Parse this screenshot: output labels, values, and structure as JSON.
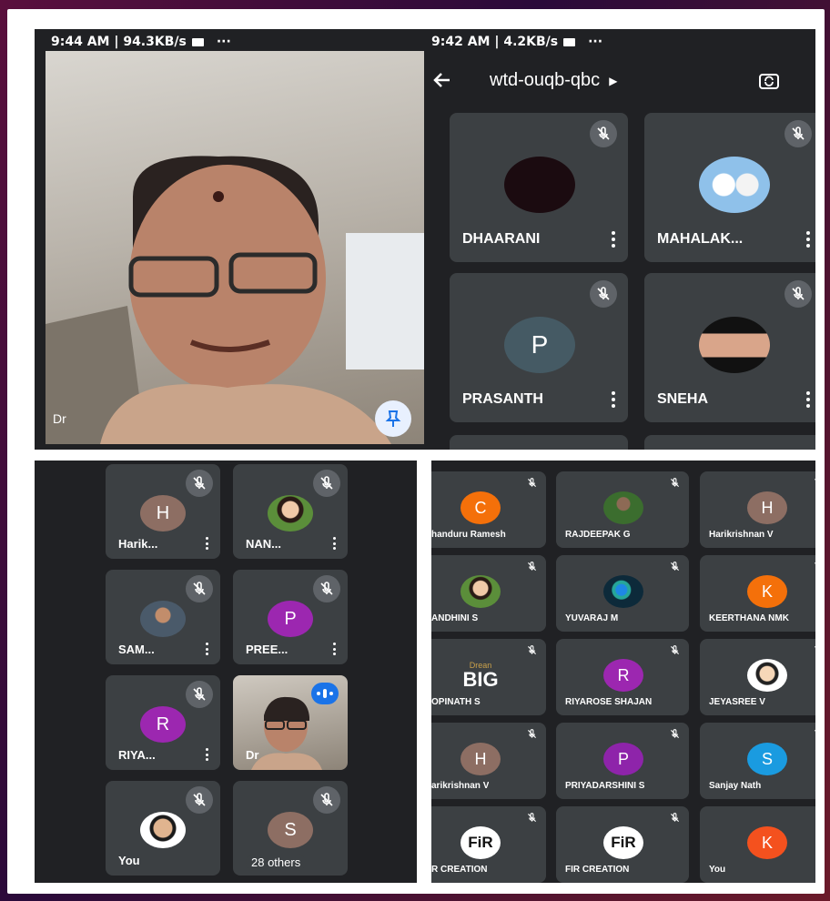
{
  "panel_a": {
    "status_left": "9:44 AM | 94.3KB/s",
    "status_dots": "···",
    "self_label": "Dr"
  },
  "panel_b": {
    "status_left": "9:42 AM | 4.2KB/s",
    "status_dots": "···",
    "meeting_code": "wtd-ouqb-qbc",
    "participants": [
      {
        "name": "DHAARANI"
      },
      {
        "name": "MAHALAK..."
      },
      {
        "name": "PRASANTH",
        "initial": "P"
      },
      {
        "name": "SNEHA"
      }
    ]
  },
  "panel_c": {
    "tiles": [
      {
        "name": "Harik...",
        "initial": "H",
        "color": "#8d6e63"
      },
      {
        "name": "NAN..."
      },
      {
        "name": "SAM..."
      },
      {
        "name": "PREE...",
        "initial": "P",
        "color": "#9c27b0"
      },
      {
        "name": "RIYA...",
        "initial": "R",
        "color": "#9c27b0"
      },
      {
        "name": "Dr"
      },
      {
        "name": "You"
      },
      {
        "initial": "S",
        "color": "#8d6e63",
        "name": "28 others"
      }
    ]
  },
  "panel_d": {
    "tiles": [
      {
        "name": "handuru Ramesh",
        "initial": "C",
        "color": "#f4700a"
      },
      {
        "name": "RAJDEEPAK G"
      },
      {
        "name": "Harikrishnan V",
        "initial": "H",
        "color": "#8d6e63"
      },
      {
        "name": "ANDHINI S"
      },
      {
        "name": "YUVARAJ M"
      },
      {
        "name": "KEERTHANA NMK",
        "initial": "K",
        "color": "#f4700a"
      },
      {
        "name": "OPINATH S",
        "logo_small": "Drean",
        "logo_big": "BIG"
      },
      {
        "name": "RIYAROSE SHAJAN",
        "initial": "R",
        "color": "#9c27b0"
      },
      {
        "name": "JEYASREE V"
      },
      {
        "name": "arikrishnan V",
        "initial": "H",
        "color": "#8d6e63"
      },
      {
        "name": "PRIYADARSHINI S",
        "initial": "P",
        "color": "#8e24aa"
      },
      {
        "name": "Sanjay Nath",
        "initial": "S",
        "color": "#1a9be0"
      },
      {
        "name": "R CREATION",
        "logo": "FiR"
      },
      {
        "name": "FIR CREATION",
        "logo": "FiR"
      },
      {
        "name": "You",
        "initial": "K",
        "color": "#f4511e"
      }
    ]
  }
}
